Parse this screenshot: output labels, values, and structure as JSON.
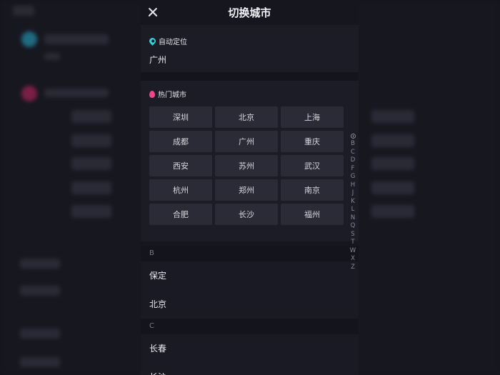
{
  "header": {
    "title": "切换城市",
    "close_icon": "close-icon"
  },
  "locate": {
    "icon": "location-pin-icon",
    "label": "自动定位",
    "city": "广州",
    "accent": "#2dd4e0"
  },
  "hot": {
    "icon": "flame-icon",
    "label": "热门城市",
    "accent": "#f0458a",
    "cities": [
      "深圳",
      "北京",
      "上海",
      "成都",
      "广州",
      "重庆",
      "西安",
      "苏州",
      "武汉",
      "杭州",
      "郑州",
      "南京",
      "合肥",
      "长沙",
      "福州"
    ]
  },
  "groups": [
    {
      "letter": "B",
      "cities": [
        "保定",
        "北京"
      ]
    },
    {
      "letter": "C",
      "cities": [
        "长春",
        "长沙"
      ]
    }
  ],
  "index": {
    "recent_icon": "clock-icon",
    "letters": [
      "B",
      "C",
      "D",
      "F",
      "G",
      "H",
      "J",
      "K",
      "L",
      "N",
      "Q",
      "S",
      "T",
      "W",
      "X",
      "Z"
    ]
  }
}
